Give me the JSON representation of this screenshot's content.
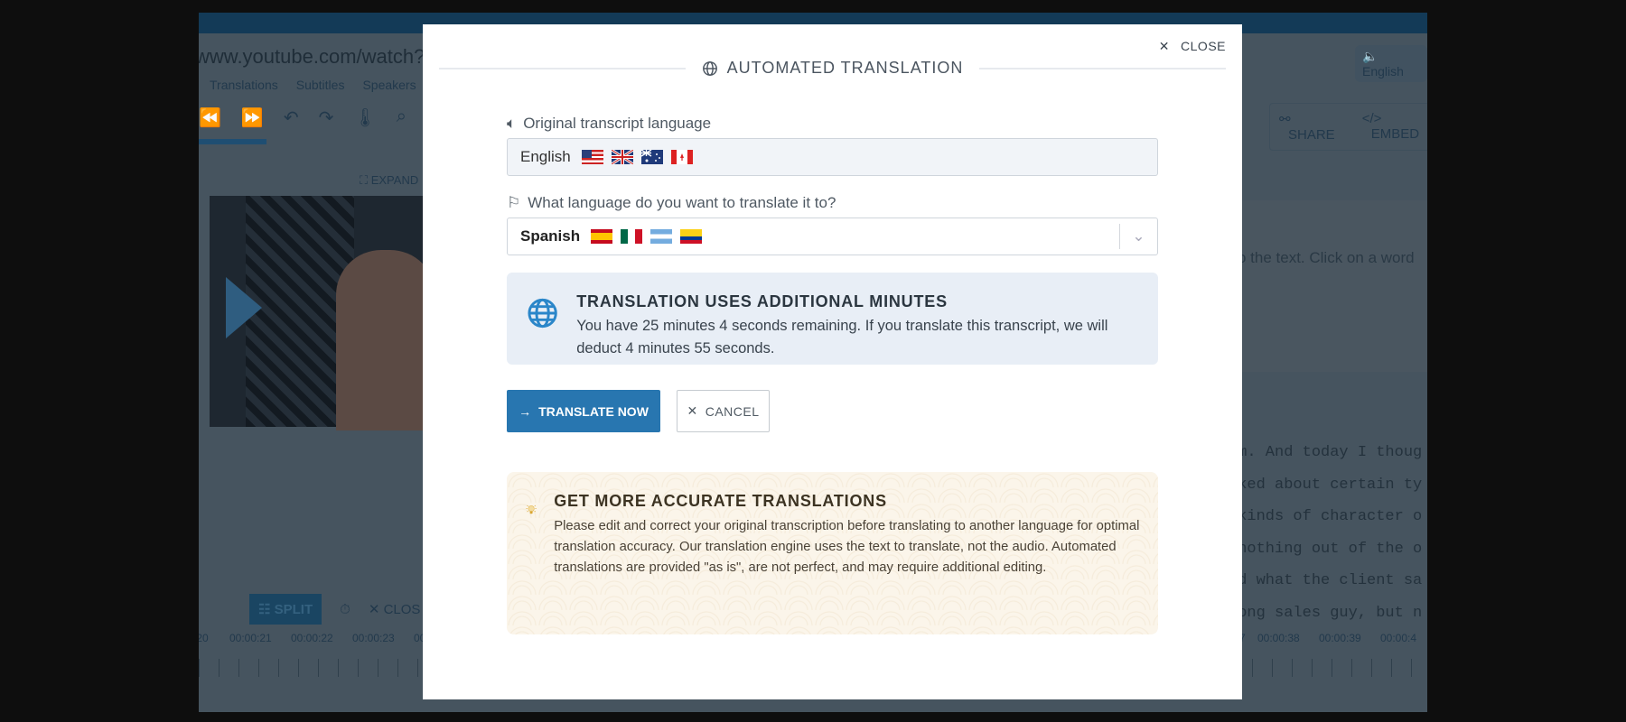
{
  "background": {
    "url": "www.youtube.com/watch?v=O",
    "tabs": [
      "Translations",
      "Subtitles",
      "Speakers"
    ],
    "expand_label": "EXPAND",
    "language_badge": "English",
    "share_label": "SHARE",
    "embed_label": "EMBED",
    "hint_text": "o the text. Click on a word",
    "transcript_lines": [
      "om. And today I thoug",
      "sked about certain ty",
      " kinds of character o",
      " nothing out of the o",
      "nd what the client sa",
      "rong sales guy, but n"
    ],
    "split_label": "SPLIT",
    "close_label": "CLOS",
    "timeline_left": [
      ":20",
      "00:00:21",
      "00:00:22",
      "00:00:23",
      "00"
    ],
    "timeline_right": [
      "7",
      "00:00:38",
      "00:00:39",
      "00:00:4"
    ]
  },
  "modal": {
    "close_label": "CLOSE",
    "title": "AUTOMATED TRANSLATION",
    "original_label": "Original transcript language",
    "original_value": "English",
    "original_flags": [
      "us",
      "gb",
      "au",
      "ca"
    ],
    "target_label": "What language do you want to translate it to?",
    "target_value": "Spanish",
    "target_flags": [
      "es",
      "mx",
      "ar",
      "co"
    ],
    "info_title": "TRANSLATION USES ADDITIONAL MINUTES",
    "info_text": "You have 25 minutes 4 seconds remaining. If you translate this transcript, we will deduct 4 minutes 55 seconds.",
    "translate_button": "TRANSLATE NOW",
    "cancel_button": "CANCEL",
    "tip_title": "GET MORE ACCURATE TRANSLATIONS",
    "tip_text": "Please edit and correct your original transcription before translating to another language for optimal translation accuracy. Our translation engine uses the text to translate, not the audio. Automated translations are provided \"as is\", are not perfect, and may require additional editing.",
    "accent_color": "#2876b0"
  }
}
